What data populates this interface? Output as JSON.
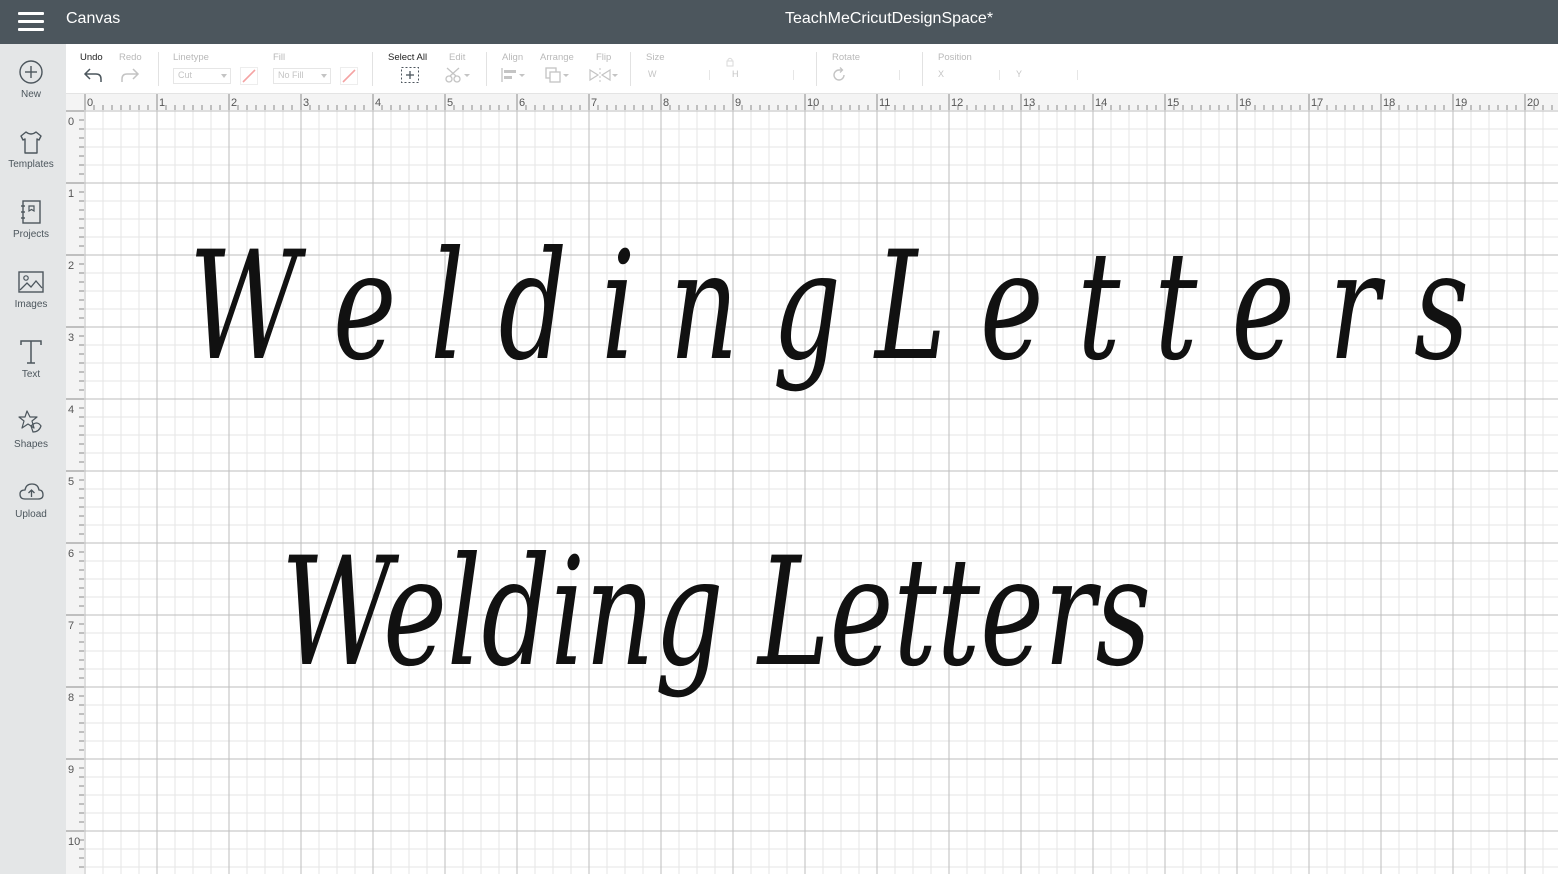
{
  "header": {
    "app_title": "Canvas",
    "doc_title": "TeachMeCricutDesignSpace*"
  },
  "sidebar": {
    "items": [
      {
        "label": "New",
        "icon": "plus-circle-icon"
      },
      {
        "label": "Templates",
        "icon": "tshirt-icon"
      },
      {
        "label": "Projects",
        "icon": "projects-icon"
      },
      {
        "label": "Images",
        "icon": "image-icon"
      },
      {
        "label": "Text",
        "icon": "text-icon"
      },
      {
        "label": "Shapes",
        "icon": "shapes-icon"
      },
      {
        "label": "Upload",
        "icon": "upload-cloud-icon"
      }
    ]
  },
  "toolbar": {
    "undo": "Undo",
    "redo": "Redo",
    "linetype": "Linetype",
    "linetype_value": "Cut",
    "fill": "Fill",
    "fill_value": "No Fill",
    "select_all": "Select All",
    "edit": "Edit",
    "align": "Align",
    "arrange": "Arrange",
    "flip": "Flip",
    "size": "Size",
    "size_w": "W",
    "size_h": "H",
    "rotate": "Rotate",
    "position": "Position",
    "pos_x": "X",
    "pos_y": "Y"
  },
  "ruler": {
    "x_labels": [
      "0",
      "1",
      "2",
      "3",
      "4",
      "5",
      "6",
      "7",
      "8",
      "9",
      "10",
      "11",
      "12",
      "13",
      "14",
      "15",
      "16",
      "17",
      "18",
      "19",
      "20"
    ],
    "y_labels": [
      "0",
      "1",
      "2",
      "3",
      "4",
      "5",
      "6",
      "7",
      "8",
      "9",
      "10"
    ]
  },
  "canvas": {
    "text_spaced": "W e l d i n g  L e t t e r s",
    "text_welded": "Welding Letters"
  }
}
